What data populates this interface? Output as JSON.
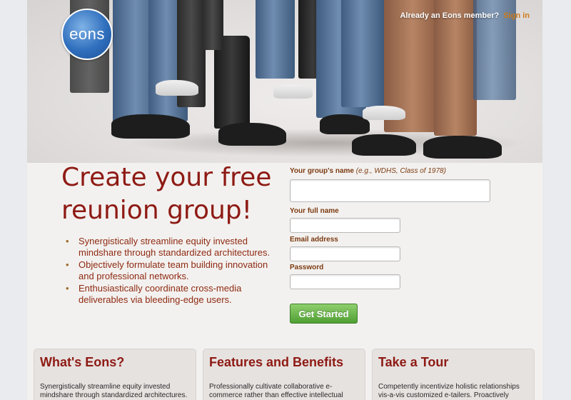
{
  "brand": {
    "logo_text": "eons",
    "logo_color": "#2f6fbd"
  },
  "header": {
    "signin_prompt": "Already an Eons member?",
    "signin_link": "Sign in"
  },
  "hero": {
    "headline": "Create your free reunion group!"
  },
  "bullets": [
    "Synergistically streamline equity invested mindshare through standardized architectures.",
    "Objectively formulate team building innovation and professional networks.",
    "Enthusiastically coordinate cross-media deliverables via bleeding-edge users."
  ],
  "form": {
    "group_name_label": "Your group's name",
    "group_name_hint": "(e.g., WDHS, Class of 1978)",
    "group_name_value": "",
    "full_name_label": "Your full name",
    "full_name_value": "",
    "email_label": "Email address",
    "email_value": "",
    "password_label": "Password",
    "password_value": "",
    "submit_label": "Get Started",
    "submit_color": "#4f9f33"
  },
  "panels": [
    {
      "title": "What's Eons?",
      "text": "Synergistically streamline equity invested mindshare through standardized architectures. Objectively"
    },
    {
      "title": "Features and Benefits",
      "text": "Professionally cultivate collaborative e-commerce rather than effective intellectual capital. Authoritatively"
    },
    {
      "title": "Take a Tour",
      "text": "Competently incentivize holistic relationships vis-a-vis customized e-tailers. Proactively reintermediate"
    }
  ],
  "colors": {
    "accent_red": "#8e1a14",
    "link_orange": "#cf7a1a",
    "background": "#e9ebee"
  }
}
